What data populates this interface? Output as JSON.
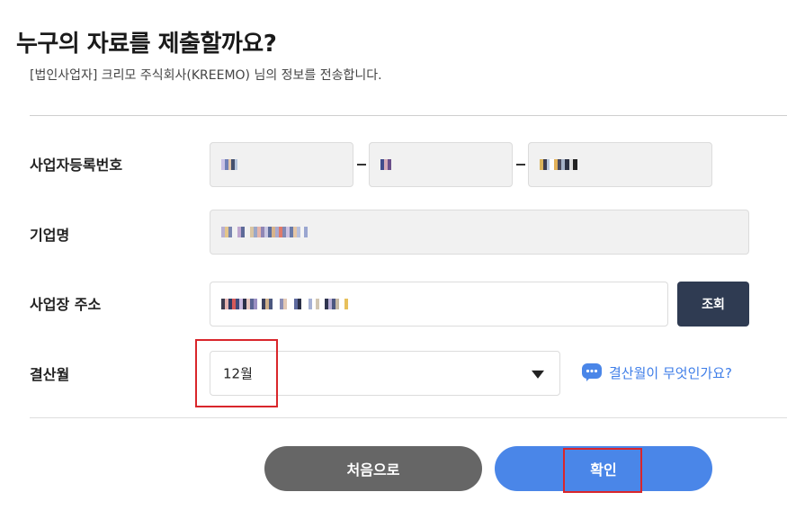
{
  "header": {
    "title": "누구의 자료를 제출할까요?",
    "subtitle": "[법인사업자] 크리모 주식회사(KREEMO) 님의 정보를 전송합니다."
  },
  "form": {
    "business_number": {
      "label": "사업자등록번호",
      "masked": true
    },
    "company_name": {
      "label": "기업명",
      "masked": true
    },
    "business_address": {
      "label": "사업장 주소",
      "masked": true,
      "search_button": "조회"
    },
    "fiscal_month": {
      "label": "결산월",
      "selected": "12월"
    },
    "help_link": "결산월이 무엇인가요?"
  },
  "actions": {
    "reset_label": "처음으로",
    "confirm_label": "확인"
  },
  "colors": {
    "primary": "#4a86e8",
    "dark_button": "#2f3b52",
    "gray_button": "#666666",
    "highlight": "#d9262b",
    "field_bg": "#f1f1f1"
  },
  "icons": {
    "help": "chat-bubble-dots-icon",
    "select": "caret-down-icon"
  }
}
